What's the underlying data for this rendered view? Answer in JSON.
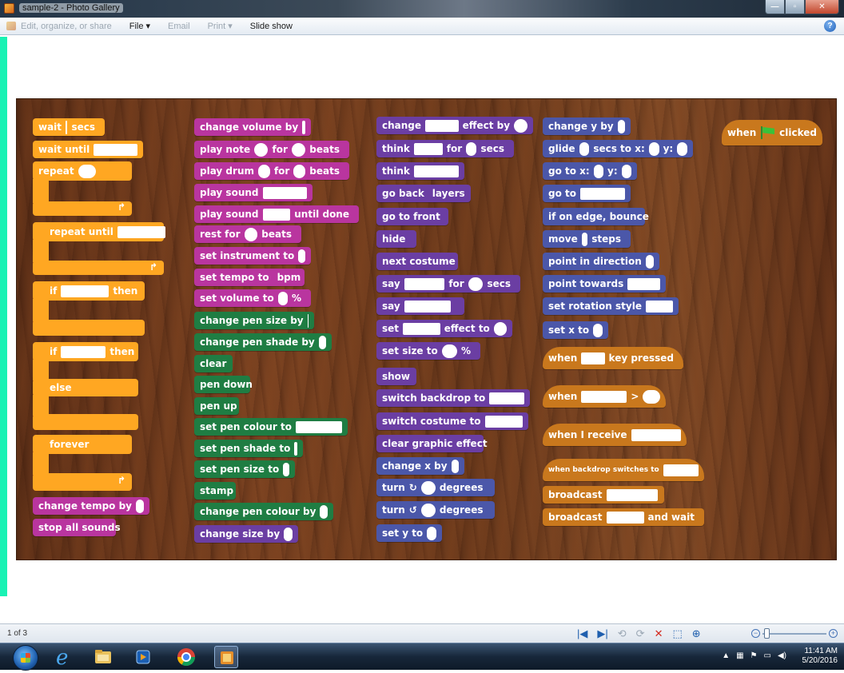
{
  "window": {
    "title": "sample-2 - Photo Gallery",
    "buttons": [
      "—",
      "▫",
      "✕"
    ]
  },
  "menu": {
    "organize": "Edit, organize, or share",
    "file": "File ▾",
    "email": "Email",
    "print": "Print ▾",
    "slideshow": "Slide show",
    "help": "?"
  },
  "blocks": {
    "wait_secs": [
      "wait",
      "secs"
    ],
    "wait_until": "wait until",
    "repeat": "repeat",
    "repeat_until": "repeat until",
    "if_then": [
      "if",
      "then"
    ],
    "if_else": [
      "if",
      "then",
      "else"
    ],
    "forever": "forever",
    "change_tempo": "change tempo by",
    "stop_sounds": "stop all sounds",
    "change_volume": "change volume by",
    "play_note": [
      "play note",
      "for",
      "beats"
    ],
    "play_drum": [
      "play drum",
      "for",
      "beats"
    ],
    "play_sound": "play sound",
    "play_sound_until": [
      "play sound",
      "until done"
    ],
    "rest_for": [
      "rest for",
      "beats"
    ],
    "set_instrument": "set instrument to",
    "set_tempo": [
      "set tempo to",
      "bpm"
    ],
    "set_volume": [
      "set volume to",
      "%"
    ],
    "change_pen_size": "change pen size by",
    "change_pen_shade": "change pen shade by",
    "clear": "clear",
    "pen_down": "pen down",
    "pen_up": "pen up",
    "set_pen_colour": "set pen colour to",
    "set_pen_shade": "set pen shade to",
    "set_pen_size": "set pen size to",
    "stamp": "stamp",
    "change_pen_colour": "change pen colour by",
    "change_size": "change size by",
    "change_effect": [
      "change",
      "effect by"
    ],
    "think_for": [
      "think",
      "for",
      "secs"
    ],
    "think": "think",
    "go_back": [
      "go back",
      "layers"
    ],
    "go_front": "go to front",
    "hide": "hide",
    "next_costume": "next costume",
    "say_for": [
      "say",
      "for",
      "secs"
    ],
    "say": "say",
    "set_effect": [
      "set",
      "effect to"
    ],
    "set_size": [
      "set size to",
      "%"
    ],
    "show": "show",
    "switch_backdrop": "switch backdrop to",
    "switch_costume": "switch costume to",
    "clear_effect": "clear graphic effect",
    "change_x": "change x by",
    "turn_cw": [
      "turn",
      "degrees"
    ],
    "turn_ccw": [
      "turn",
      "degrees"
    ],
    "set_y": "set y to",
    "change_y": "change y by",
    "glide": [
      "glide",
      "secs to x:",
      "y:"
    ],
    "go_to_xy": [
      "go to x:",
      "y:"
    ],
    "go_to": "go to",
    "bounce": "if on edge, bounce",
    "move": [
      "move",
      "steps"
    ],
    "point_direction": "point in direction",
    "point_towards": "point towards",
    "rotation_style": "set rotation style",
    "set_x": "set x to",
    "when_key": [
      "when",
      "key pressed"
    ],
    "when_gt": [
      "when",
      ">"
    ],
    "when_receive": "when I receive",
    "when_backdrop": "when backdrop switches to",
    "broadcast": "broadcast",
    "broadcast_wait": [
      "broadcast",
      "and wait"
    ],
    "when_flag": [
      "when",
      "clicked"
    ]
  },
  "status": {
    "count": "1 of 3",
    "nav": [
      "|◀",
      "▶|",
      "⟲",
      "⟳",
      "✕",
      "⬚",
      "⊕"
    ],
    "zoom_minus": "−",
    "zoom_plus": "+"
  },
  "taskbar": {
    "time": "11:41 AM",
    "date": "5/20/2016"
  },
  "colors": {
    "control": "#ffa722",
    "sound": "#b9359f",
    "pen": "#1f7d43",
    "looks": "#6b3ea3",
    "motion": "#4b57a9",
    "events": "#c9781d"
  }
}
